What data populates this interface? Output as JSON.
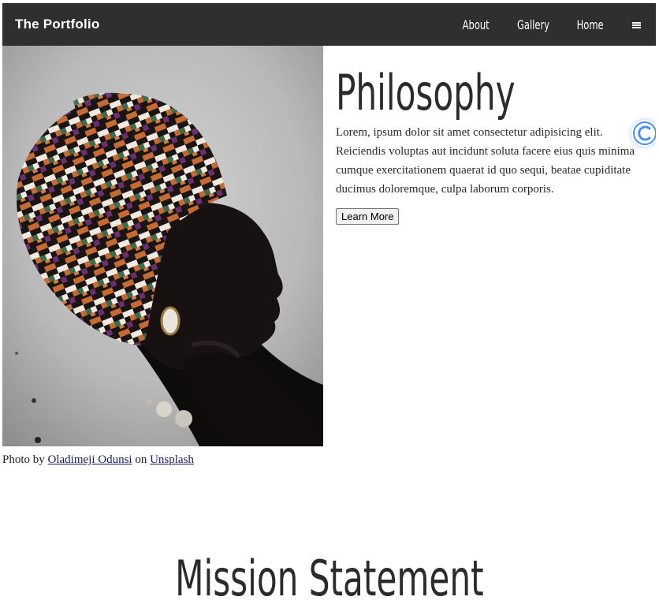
{
  "nav": {
    "brand": "The Portfolio",
    "links": [
      "About",
      "Gallery",
      "Home"
    ],
    "menu_icon": "hamburger-menu-icon"
  },
  "hero": {
    "image_alt": "Portrait of a woman wearing a patterned head wrap",
    "caption_prefix": "Photo by",
    "caption_author": "Oladimeji Odunsi",
    "caption_mid": "on",
    "caption_source": "Unsplash"
  },
  "philosophy": {
    "heading": "Philosophy",
    "body": "Lorem, ipsum dolor sit amet consectetur adipisicing elit. Reiciendis voluptas aut incidunt soluta facere eius quis minima cumque exercitationem quaerat id quo sequi, beatae cupiditate ducimus doloremque, culpa laborum corporis.",
    "button_label": "Learn More"
  },
  "mission": {
    "heading": "Mission Statement"
  },
  "extension_badge": {
    "icon": "extension-c-icon",
    "color": "#4a8ef0"
  },
  "colors": {
    "navbar_bg": "#2f2f2f",
    "heading": "#2b2b2b",
    "link": "#1a1a66"
  }
}
